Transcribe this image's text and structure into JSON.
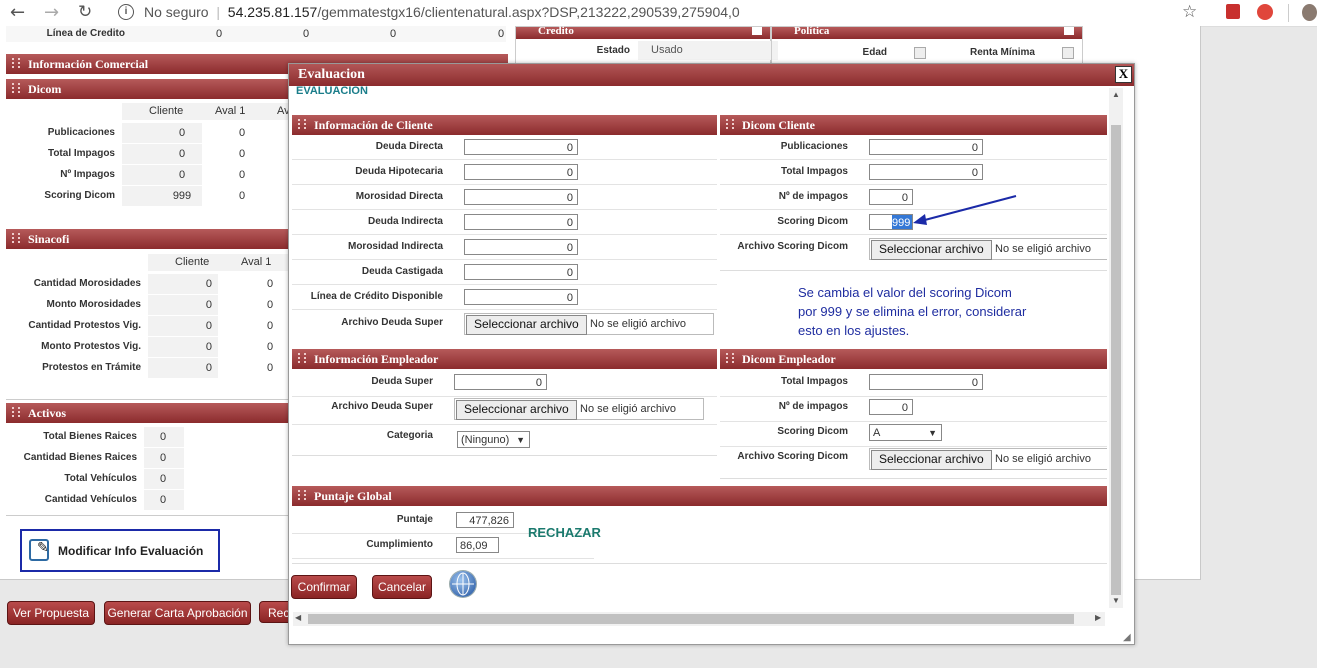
{
  "browser": {
    "security": "No seguro",
    "url_domain": "54.235.81.157",
    "url_path": "/gemmatestgx16/clientenatural.aspx?DSP,213222,290539,275904,0"
  },
  "bg": {
    "linea_credito": {
      "label": "Línea de Credito",
      "values": [
        "0",
        "0",
        "0",
        "0"
      ]
    },
    "credito": {
      "title": "Credito",
      "estado_label": "Estado",
      "estado_value": "Usado"
    },
    "politica": {
      "title": "Política",
      "edad_label": "Edad",
      "renta_label": "Renta Mínima"
    },
    "info_comercial": {
      "title": "Información Comercial"
    },
    "dicom": {
      "title": "Dicom",
      "headers": [
        "Cliente",
        "Aval 1",
        "Av"
      ],
      "rows": [
        {
          "label": "Publicaciones",
          "values": [
            "0",
            "0"
          ]
        },
        {
          "label": "Total Impagos",
          "values": [
            "0",
            "0"
          ]
        },
        {
          "label": "Nº Impagos",
          "values": [
            "0",
            "0"
          ]
        },
        {
          "label": "Scoring Dicom",
          "values": [
            "999",
            "0"
          ]
        }
      ]
    },
    "sinacofi": {
      "title": "Sinacofi",
      "headers": [
        "Cliente",
        "Aval 1"
      ],
      "rows": [
        {
          "label": "Cantidad Morosidades",
          "values": [
            "0",
            "0"
          ]
        },
        {
          "label": "Monto Morosidades",
          "values": [
            "0",
            "0"
          ]
        },
        {
          "label": "Cantidad Protestos Vig.",
          "values": [
            "0",
            "0"
          ]
        },
        {
          "label": "Monto Protestos Vig.",
          "values": [
            "0",
            "0"
          ]
        },
        {
          "label": "Protestos en Trámite",
          "values": [
            "0",
            "0"
          ]
        }
      ]
    },
    "activos": {
      "title": "Activos",
      "rows": [
        {
          "label": "Total Bienes Raices",
          "value": "0"
        },
        {
          "label": "Cantidad Bienes Raices",
          "value": "0"
        },
        {
          "label": "Total Vehículos",
          "value": "0"
        },
        {
          "label": "Cantidad Vehículos",
          "value": "0"
        }
      ]
    },
    "modificar_label": "Modificar Info Evaluación",
    "buttons": {
      "ver_propuesta": "Ver Propuesta",
      "generar_carta": "Generar Carta Aprobación",
      "rec": "Rec"
    }
  },
  "modal": {
    "title": "Evaluacion",
    "subtitle": "EVALUACION",
    "close": "X",
    "info_cliente": {
      "title": "Información de Cliente",
      "fields": [
        {
          "label": "Deuda Directa",
          "value": "0"
        },
        {
          "label": "Deuda Hipotecaria",
          "value": "0"
        },
        {
          "label": "Morosidad Directa",
          "value": "0"
        },
        {
          "label": "Deuda Indirecta",
          "value": "0"
        },
        {
          "label": "Morosidad Indirecta",
          "value": "0"
        },
        {
          "label": "Deuda Castigada",
          "value": "0"
        },
        {
          "label": "Línea de Crédito Disponible",
          "value": "0"
        }
      ],
      "file_label": "Archivo Deuda Super"
    },
    "dicom_cliente": {
      "title": "Dicom Cliente",
      "fields": [
        {
          "label": "Publicaciones",
          "value": "0"
        },
        {
          "label": "Total Impagos",
          "value": "0"
        },
        {
          "label": "Nº de impagos",
          "value": "0"
        },
        {
          "label": "Scoring Dicom",
          "value": "999"
        }
      ],
      "file_label": "Archivo Scoring Dicom"
    },
    "note": [
      "Se cambia el valor del scoring Dicom",
      "por 999 y se elimina el error, considerar",
      "esto en los ajustes."
    ],
    "info_empleador": {
      "title": "Información Empleador",
      "deuda_super_label": "Deuda Super",
      "deuda_super_value": "0",
      "file_label": "Archivo Deuda Super",
      "categoria_label": "Categoria",
      "categoria_value": "(Ninguno)"
    },
    "dicom_empleador": {
      "title": "Dicom Empleador",
      "total_impagos_label": "Total Impagos",
      "total_impagos_value": "0",
      "n_impagos_label": "Nº de impagos",
      "n_impagos_value": "0",
      "scoring_label": "Scoring Dicom",
      "scoring_value": "A",
      "file_label": "Archivo Scoring Dicom"
    },
    "puntaje": {
      "title": "Puntaje Global",
      "puntaje_label": "Puntaje",
      "puntaje_value": "477,826",
      "cumplimiento_label": "Cumplimiento",
      "cumplimiento_value": "86,09",
      "resultado": "RECHAZAR"
    },
    "file_button": "Seleccionar archivo",
    "file_none": "No se eligió archivo",
    "confirmar": "Confirmar",
    "cancelar": "Cancelar"
  },
  "colors": {
    "accent": "#8b2b2d",
    "annotation": "#1f2da0",
    "result": "#1b7a6e"
  }
}
